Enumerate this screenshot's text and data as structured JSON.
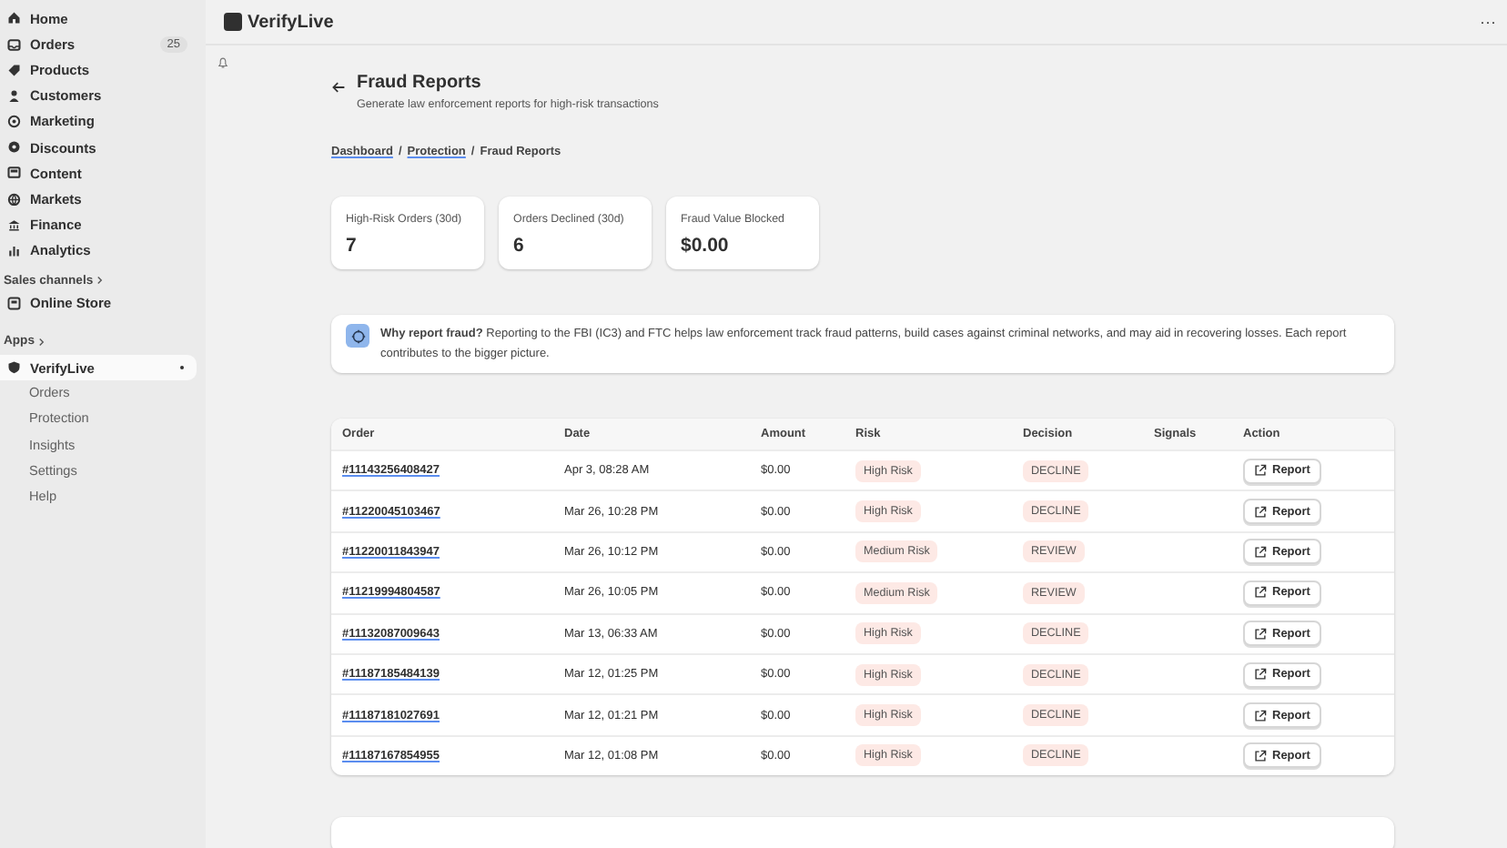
{
  "sidebar": {
    "items": [
      {
        "label": "Home",
        "selected": false
      },
      {
        "label": "Orders",
        "badge": "25",
        "selected": false
      },
      {
        "label": "Products",
        "selected": false
      },
      {
        "label": "Customers",
        "selected": false
      },
      {
        "label": "Marketing",
        "selected": false
      },
      {
        "label": "Discounts",
        "selected": false
      },
      {
        "label": "Content",
        "selected": false
      },
      {
        "label": "Markets",
        "selected": false
      },
      {
        "label": "Finance",
        "selected": false
      },
      {
        "label": "Analytics",
        "selected": false
      }
    ],
    "sales_channels": {
      "heading": "Sales channels",
      "items": [
        {
          "label": "Online Store",
          "selected": false
        }
      ]
    },
    "apps": {
      "heading": "Apps",
      "items": [
        {
          "label": "VerifyLive",
          "selected": true,
          "children": [
            {
              "label": "Orders"
            },
            {
              "label": "Protection"
            },
            {
              "label": "Insights"
            },
            {
              "label": "Settings"
            },
            {
              "label": "Help"
            }
          ]
        }
      ]
    }
  },
  "topbar": {
    "title": "VerifyLive",
    "menu": "···"
  },
  "page": {
    "title": "Fraud Reports",
    "subtitle": "Generate law enforcement reports for high-risk transactions",
    "breadcrumb_separator": "/",
    "breadcrumb": [
      {
        "label": "Dashboard",
        "link": true
      },
      {
        "label": "Protection",
        "link": true
      },
      {
        "label": "Fraud Reports",
        "link": false
      }
    ]
  },
  "stats": [
    {
      "label": "High-Risk Orders (30d)",
      "value": "7"
    },
    {
      "label": "Orders Declined (30d)",
      "value": "6"
    },
    {
      "label": "Fraud Value Blocked",
      "value": "$0.00"
    }
  ],
  "notice": {
    "text": "**Why report fraud?** Reporting to the FBI (IC3) and FTC helps law enforcement track fraud patterns, build cases against criminal networks, and may aid in recovering losses. Each report contributes to the bigger picture."
  },
  "table": {
    "columns": [
      "Order",
      "Date",
      "Amount",
      "Risk",
      "Decision",
      "Signals",
      "Action"
    ],
    "rows": [
      {
        "order": "#11143256408427",
        "date": "Apr 3, 08:28 AM",
        "amount": "$0.00",
        "risk": "High Risk",
        "decision": "DECLINE",
        "action": "Report"
      },
      {
        "order": "#11220045103467",
        "date": "Mar 26, 10:28 PM",
        "amount": "$0.00",
        "risk": "High Risk",
        "decision": "DECLINE",
        "action": "Report"
      },
      {
        "order": "#11220011843947",
        "date": "Mar 26, 10:12 PM",
        "amount": "$0.00",
        "risk": "Medium Risk",
        "decision": "REVIEW",
        "action": "Report"
      },
      {
        "order": "#11219994804587",
        "date": "Mar 26, 10:05 PM",
        "amount": "$0.00",
        "risk": "Medium Risk",
        "decision": "REVIEW",
        "action": "Report"
      },
      {
        "order": "#11132087009643",
        "date": "Mar 13, 06:33 AM",
        "amount": "$0.00",
        "risk": "High Risk",
        "decision": "DECLINE",
        "action": "Report"
      },
      {
        "order": "#11187185484139",
        "date": "Mar 12, 01:25 PM",
        "amount": "$0.00",
        "risk": "High Risk",
        "decision": "DECLINE",
        "action": "Report"
      },
      {
        "order": "#11187181027691",
        "date": "Mar 12, 01:21 PM",
        "amount": "$0.00",
        "risk": "High Risk",
        "decision": "DECLINE",
        "action": "Report"
      },
      {
        "order": "#11187167854955",
        "date": "Mar 12, 01:08 PM",
        "amount": "$0.00",
        "risk": "High Risk",
        "decision": "DECLINE",
        "action": "Report"
      }
    ]
  }
}
